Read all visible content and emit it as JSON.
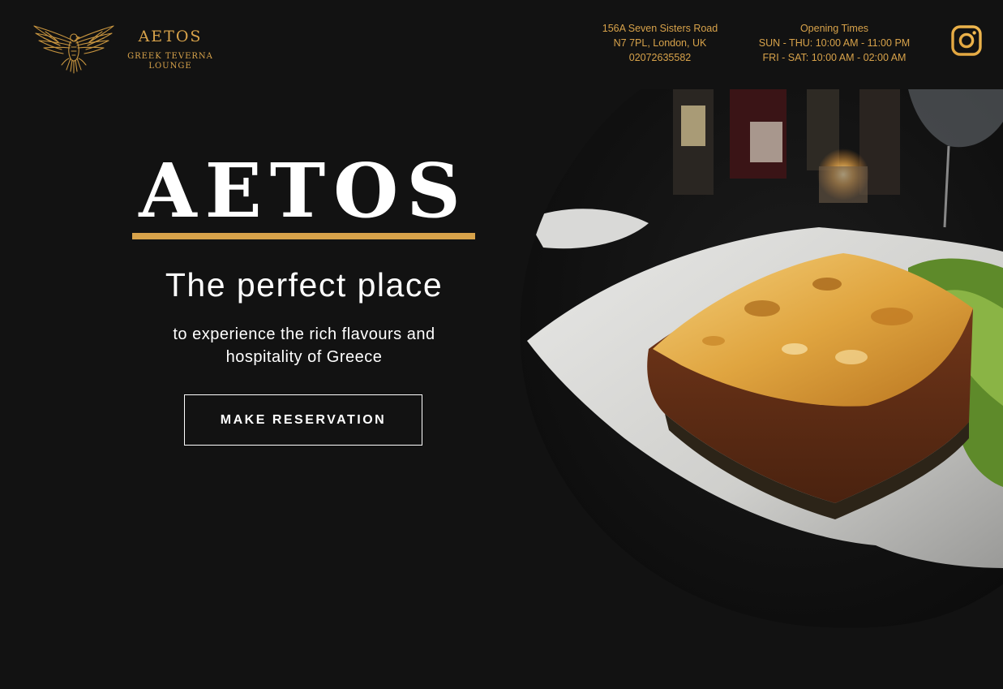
{
  "brand": {
    "name": "AETOS",
    "tagline_line1": "GREEK TEVERNA",
    "tagline_line2": "LOUNGE",
    "accent_color": "#d7a24a",
    "logo_icon": "eagle-icon"
  },
  "contact": {
    "address_line1": "156A Seven Sisters Road",
    "address_line2": "N7 7PL, London, UK",
    "phone": "02072635582"
  },
  "hours": {
    "title": "Opening Times",
    "weekday": "SUN - THU: 10:00 AM - 11:00 PM",
    "weekend": "FRI - SAT: 10:00 AM - 02:00 AM"
  },
  "social": {
    "icon": "instagram-icon"
  },
  "hero": {
    "title": "AETOS",
    "subtitle": "The perfect place",
    "description": "to experience the rich flavours and hospitality of Greece",
    "button_label": "MAKE RESERVATION"
  },
  "colors": {
    "background": "#121212",
    "accent": "#d7a24a",
    "text": "#ffffff"
  }
}
